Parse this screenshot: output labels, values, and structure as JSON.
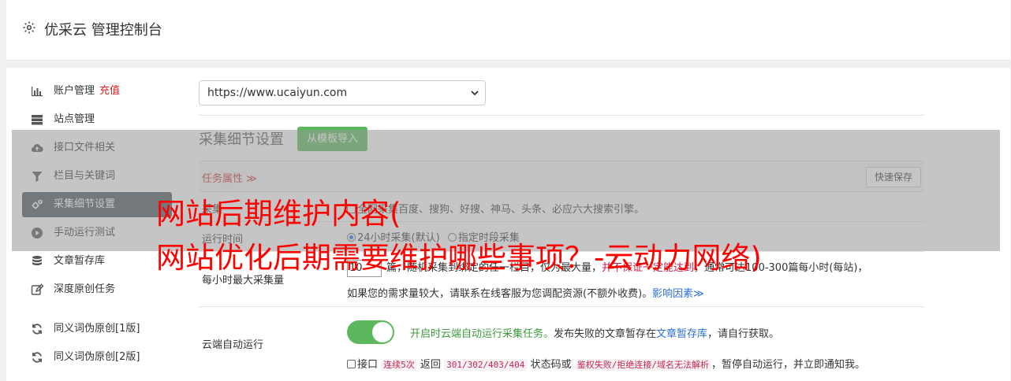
{
  "header": {
    "title": "优采云 管理控制台"
  },
  "sidebar": {
    "items": [
      {
        "label": "账户管理",
        "badge": "充值",
        "icon": "bar-chart-icon"
      },
      {
        "label": "站点管理",
        "icon": "server-icon"
      },
      {
        "label": "接口文件相关",
        "icon": "cloud-upload-icon"
      },
      {
        "label": "栏目与关键词",
        "icon": "filter-icon"
      },
      {
        "label": "采集细节设置",
        "icon": "cogs-icon",
        "active": true
      },
      {
        "label": "手动运行测试",
        "icon": "play-icon"
      },
      {
        "label": "文章暂存库",
        "icon": "database-icon"
      },
      {
        "label": "深度原创任务",
        "icon": "edit-icon"
      },
      {
        "label": "同义词伪原创[1版]",
        "icon": "refresh-icon"
      },
      {
        "label": "同义词伪原创[2版]",
        "icon": "refresh-icon"
      }
    ]
  },
  "main": {
    "url_select": "https://www.ucaiyun.com",
    "section_title": "采集细节设置",
    "template_button": "从模板导入",
    "tasks_label": "任务属性 ≫",
    "save_button": "快速保存",
    "row1": {
      "label": "采集",
      "value": "全网采集百度、搜狗、好搜、神马、头条、必应六大搜索引擎。"
    },
    "row2": {
      "label": "运行时间",
      "opt1": "24小时采集(默认)",
      "opt2": "指定时段采集"
    },
    "row3": {
      "label": "每小时最大采集量",
      "input": "10",
      "text_a": "篇，随机采集到绑定的任一栏目，仅为最大量，",
      "text_red": "并不保证一定能达到",
      "text_b": "，通常可达100-300篇每小时(每站)，",
      "line2": "如果您的需求量较大，请联系在线客服为您调配资源(不额外收费)。",
      "link": "影响因素"
    },
    "row4": {
      "label": "云端自动运行",
      "green": "开启时云端自动运行采集任务。",
      "text_a": "发布失败的文章暂存在",
      "link": "文章暂存库",
      "text_b": "，请自行获取。",
      "chk_a": "接口",
      "code1": "连续5次",
      "chk_b": "返回",
      "code2": "301/302/403/404",
      "chk_c": "状态码或",
      "code3": "鉴权失败/拒绝连接/域名无法解析",
      "chk_d": "，暂停自动运行，并立即通知我。"
    }
  },
  "overlay": {
    "line1": "网站后期维护内容(",
    "line2": "网站优化后期需要维护哪些事项？-云动力网络)"
  }
}
